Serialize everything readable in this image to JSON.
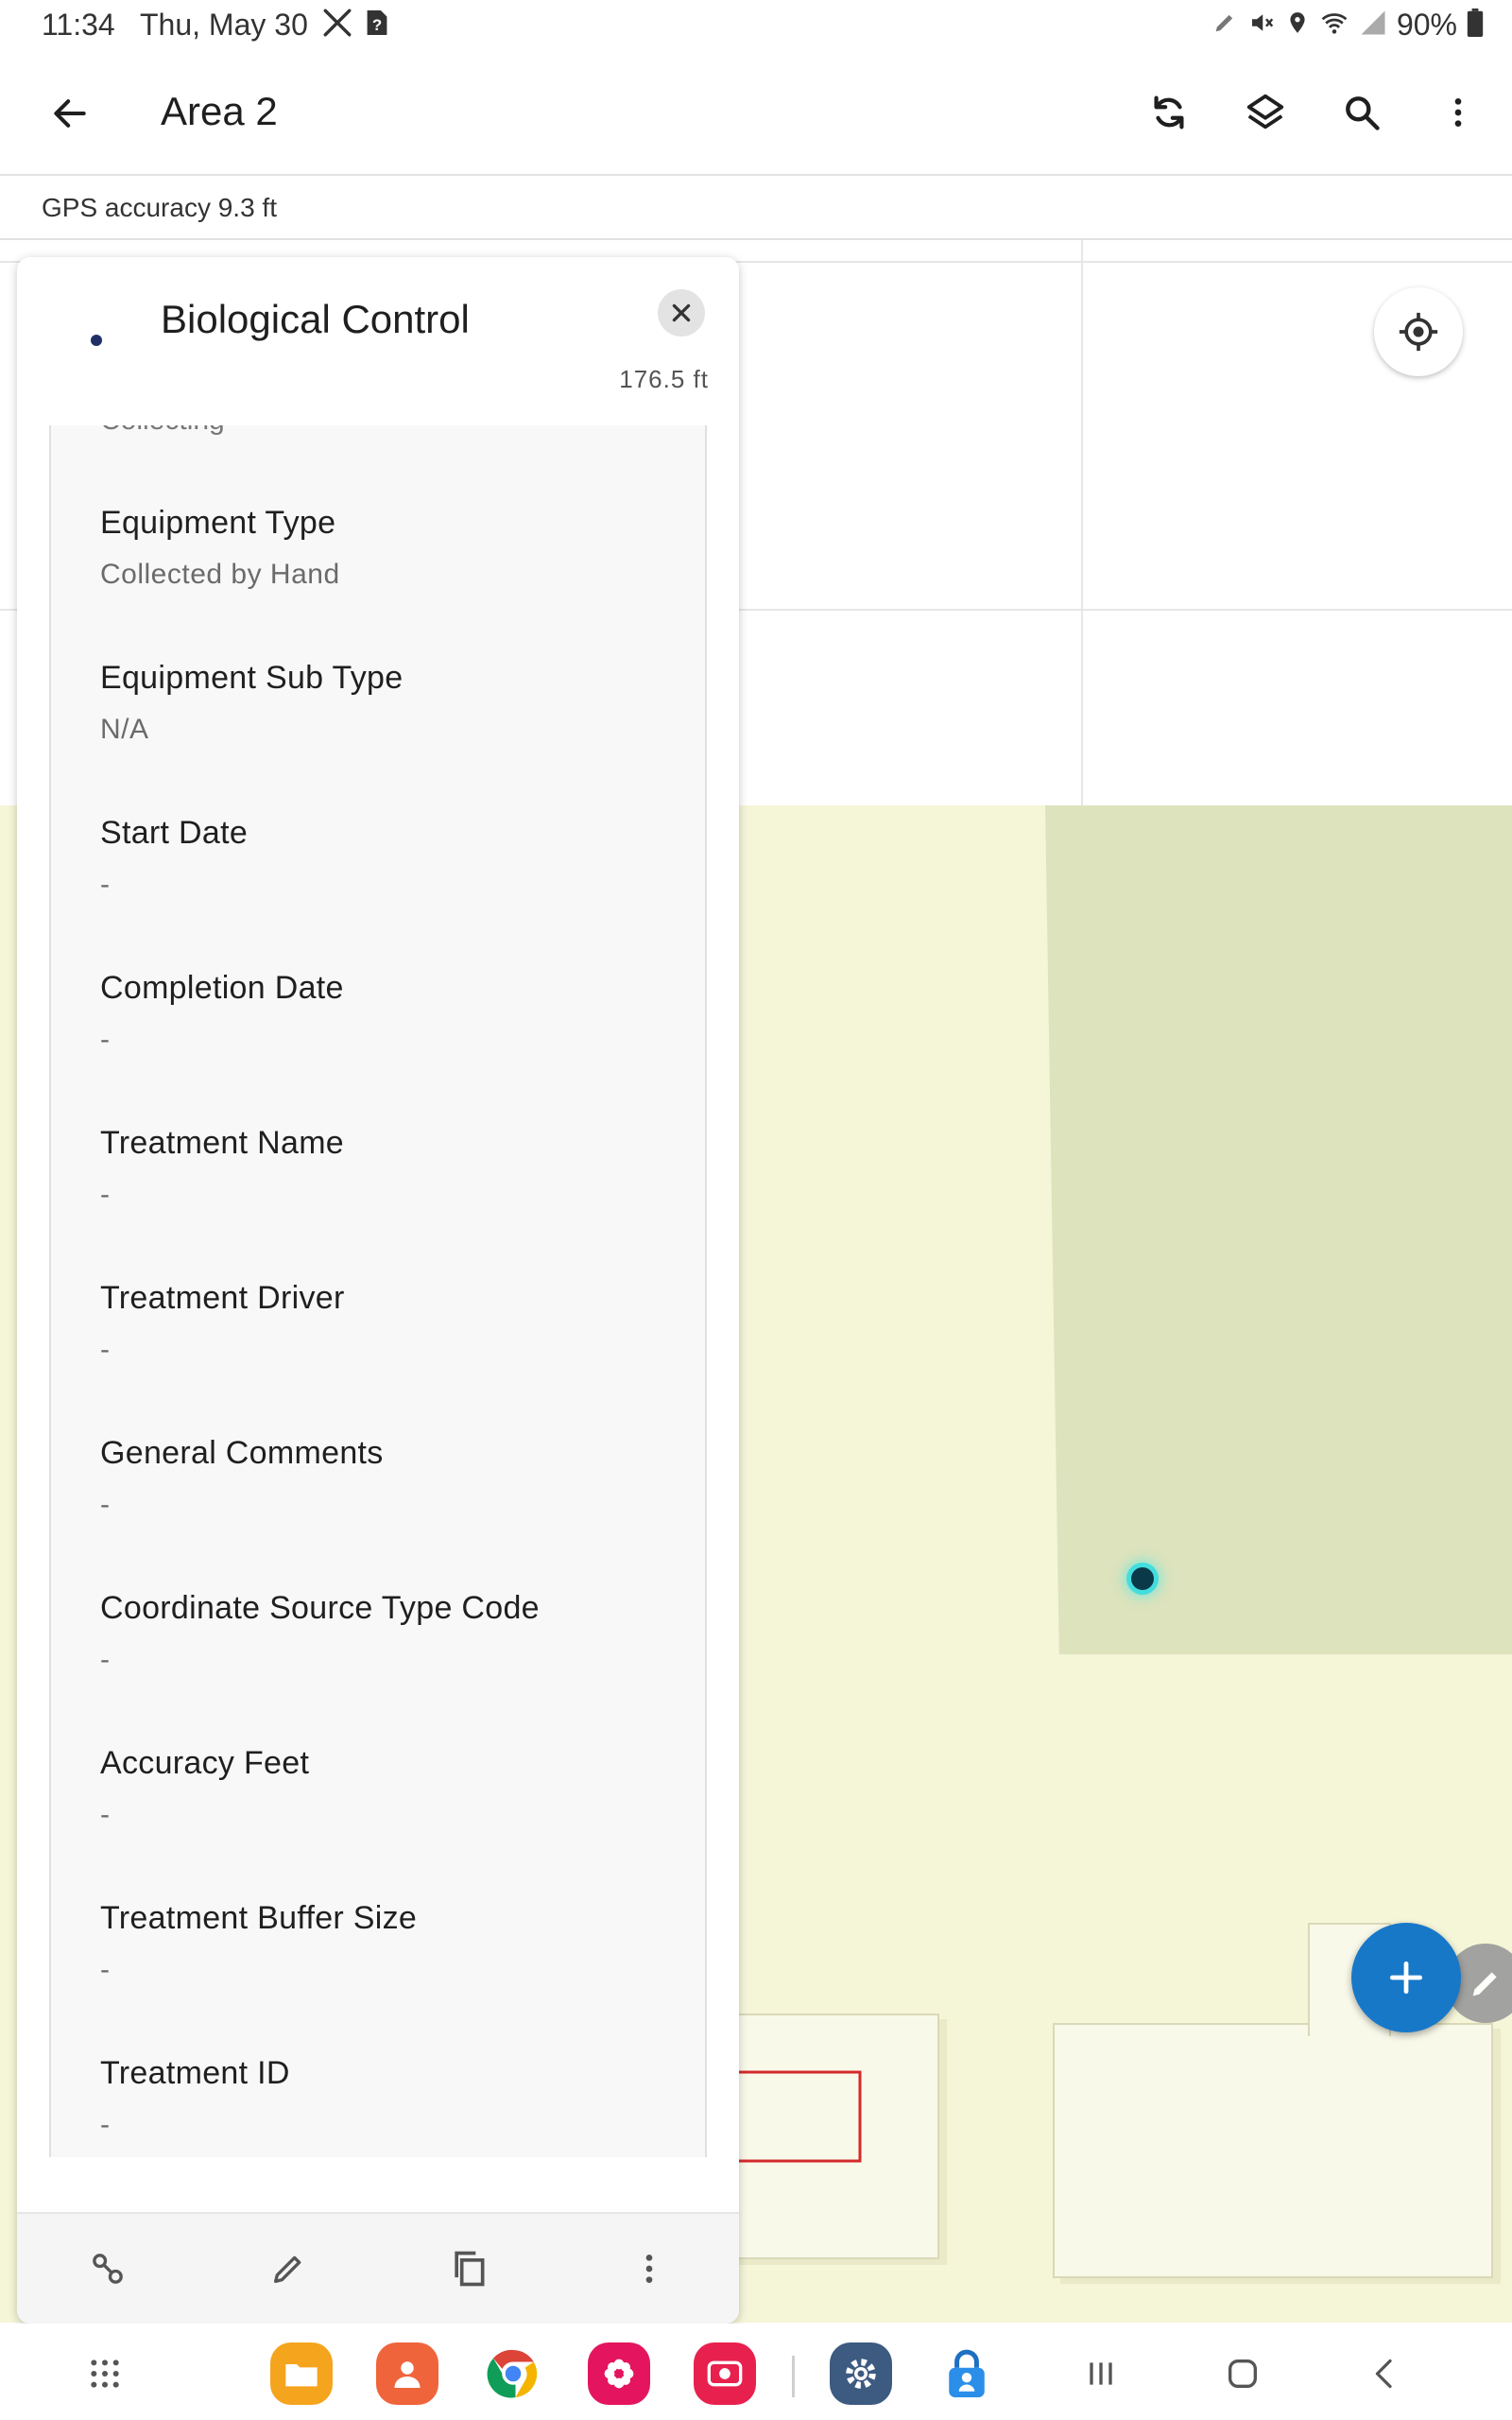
{
  "status_bar": {
    "time": "11:34",
    "date": "Thu, May 30",
    "battery": "90%",
    "left_icons": [
      "tools-icon",
      "sim-alert-icon"
    ],
    "right_icons": [
      "pen-icon",
      "mute-icon",
      "location-icon",
      "wifi-icon",
      "signal-icon",
      "battery-icon"
    ]
  },
  "app_bar": {
    "title": "Area 2",
    "actions": [
      "sync-icon",
      "layers-icon",
      "search-icon",
      "more-vert-icon"
    ]
  },
  "gps": {
    "accuracy_text": "GPS accuracy 9.3 ft"
  },
  "panel": {
    "title": "Biological Control",
    "distance": "176.5 ft",
    "cut_off_label": "Collecting",
    "fields": [
      {
        "label": "Equipment Type",
        "value": "Collected by Hand"
      },
      {
        "label": "Equipment Sub Type",
        "value": "N/A"
      },
      {
        "label": "Start Date",
        "value": "-"
      },
      {
        "label": "Completion Date",
        "value": "-"
      },
      {
        "label": "Treatment Name",
        "value": "-"
      },
      {
        "label": "Treatment Driver",
        "value": "-"
      },
      {
        "label": "General Comments",
        "value": "-"
      },
      {
        "label": "Coordinate Source Type Code",
        "value": "-"
      },
      {
        "label": "Accuracy Feet",
        "value": "-"
      },
      {
        "label": "Treatment Buffer Size",
        "value": "-"
      },
      {
        "label": "Treatment ID",
        "value": "-"
      }
    ],
    "footer_actions": [
      "link-icon",
      "edit-icon",
      "copy-icon",
      "more-vert-icon"
    ]
  },
  "colors": {
    "fab": "#1878c8",
    "map_land": "#f5f5d8",
    "parcel": "#dde3bc",
    "annotation_arrow": "#d42a2a"
  },
  "nav_bar": {
    "apps": [
      "app-drawer-icon",
      "my-files-icon",
      "contacts-icon",
      "chrome-icon",
      "gallery-icon",
      "screen-recorder-icon",
      "settings-icon",
      "authenticator-icon"
    ],
    "system": [
      "recents-icon",
      "home-icon",
      "back-icon"
    ]
  }
}
